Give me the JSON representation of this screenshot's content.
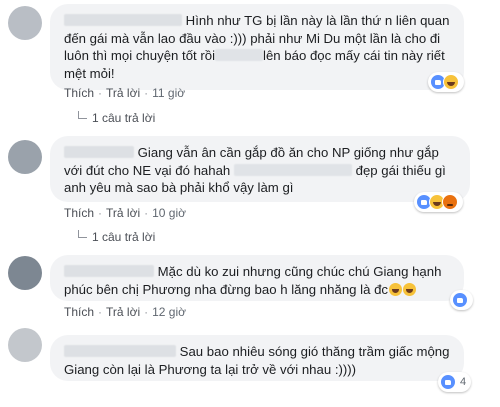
{
  "comments": [
    {
      "text_part1": "Hình như TG bị lần này là lần thứ n liên quan đến gái mà vẫn lao đầu vào :))) phải như Mi Du một lần là cho đi luôn thì mọi chuyện tốt rồi",
      "text_part2": "lên báo đọc mấy cái tin này riết mệt mỏi!",
      "reaction_count": "",
      "reactions": [
        "like-icon",
        "haha-icon"
      ],
      "like_label": "Thích",
      "reply_label": "Trả lời",
      "time": "11 giờ",
      "replies": "1 câu trả lời"
    },
    {
      "text_part1": "Giang vẫn ân cần gắp đồ ăn cho NP giống như gắp với đút cho NE vại đó hahah",
      "text_part2": "đẹp gái thiếu gì anh yêu mà sao bà phải khổ vậy làm gì",
      "reaction_count": "",
      "reactions": [
        "like-icon",
        "haha-icon",
        "angry-icon"
      ],
      "like_label": "Thích",
      "reply_label": "Trả lời",
      "time": "10 giờ",
      "replies": "1 câu trả lời"
    },
    {
      "text_part1": "Mặc dù ko zui nhưng cũng chúc chú Giang hạnh phúc bên chị Phương nha đừng bao h lăng nhăng là đc",
      "text_part2": "",
      "reaction_count": "",
      "reactions": [
        "like-icon"
      ],
      "like_label": "Thích",
      "reply_label": "Trả lời",
      "time": "12 giờ",
      "replies": ""
    },
    {
      "text_part1": "Sau bao nhiêu sóng gió thăng trầm giấc mộng Giang còn lại là Phương ta lại trở về với nhau :))))",
      "text_part2": "",
      "reaction_count": "4",
      "reactions": [
        "like-icon"
      ],
      "like_label": "",
      "reply_label": "",
      "time": "",
      "replies": ""
    }
  ]
}
